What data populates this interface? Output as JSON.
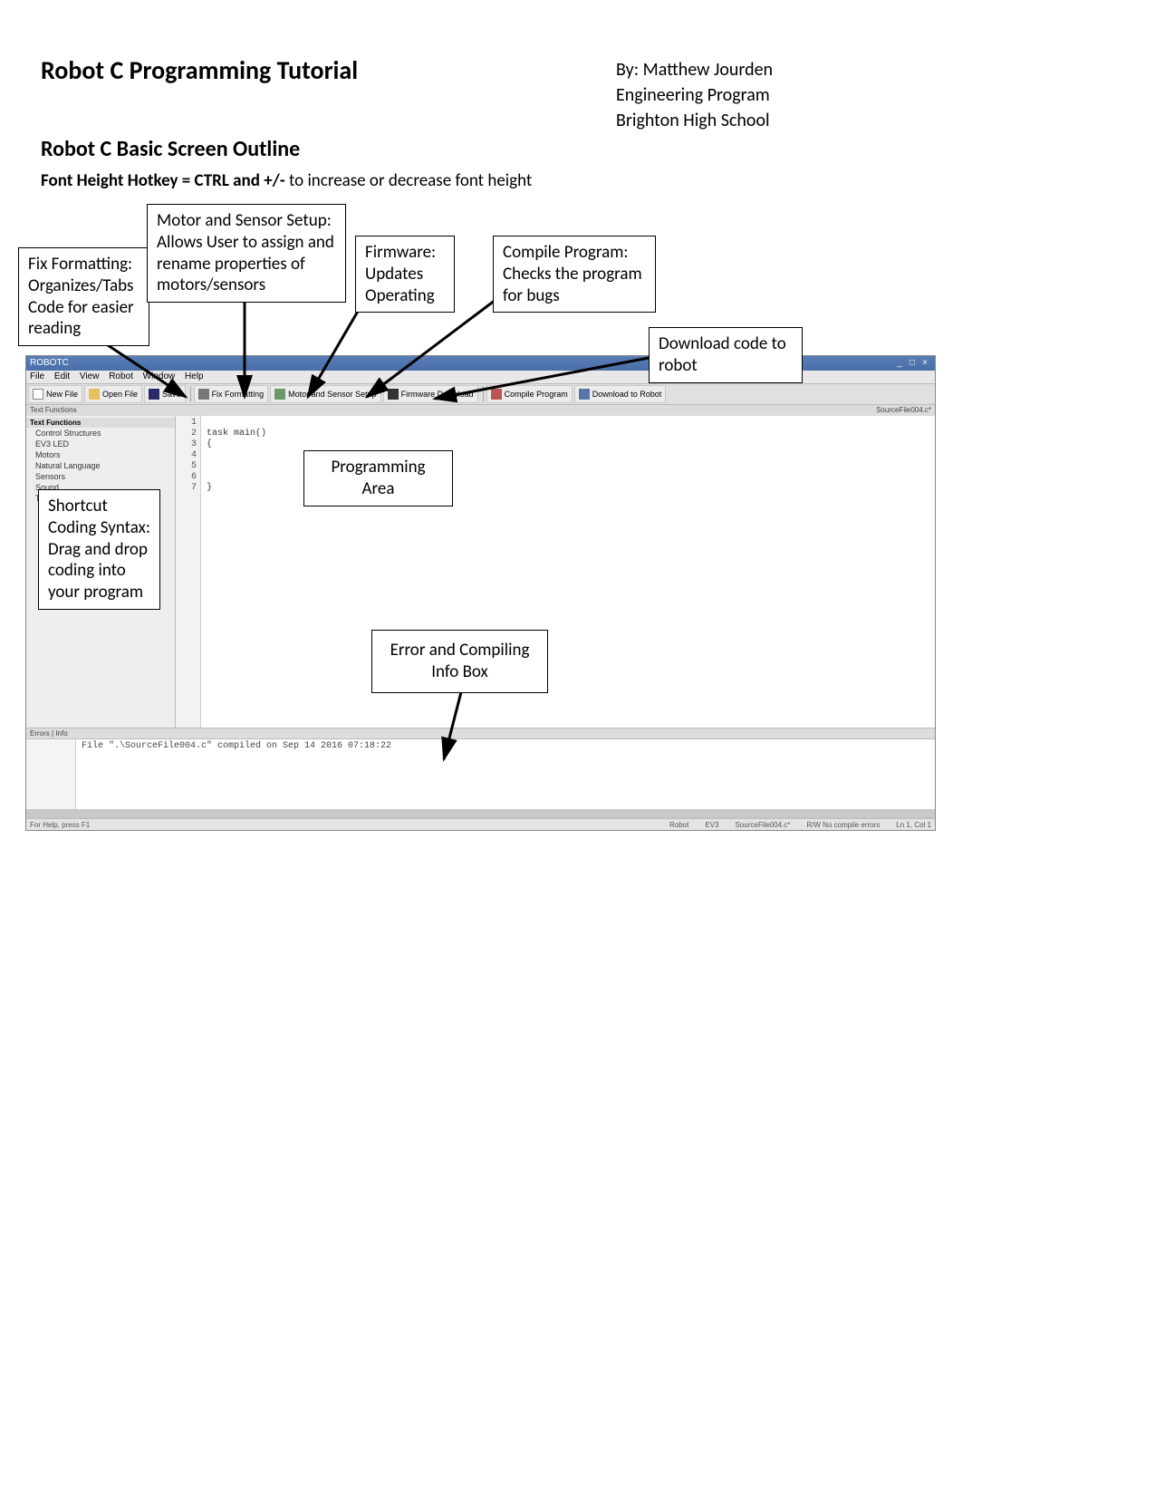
{
  "header": {
    "title": "Robot C Programming Tutorial",
    "by": "By: Matthew Jourden",
    "program": "Engineering Program",
    "school": "Brighton High School"
  },
  "section_title": "Robot C Basic Screen Outline",
  "hotkey_bold": "Font Height Hotkey = CTRL and +/-",
  "hotkey_rest": " to increase or decrease font height",
  "callouts": {
    "fix_formatting": "Fix Formatting: Organizes/Tabs Code for easier reading",
    "motor_sensor": "Motor and Sensor Setup: Allows User to assign and rename properties of motors/sensors",
    "firmware": "Firmware: Updates Operating",
    "compile": "Compile Program: Checks the program for bugs",
    "download": "Download code to robot",
    "prog_area": "Programming Area",
    "shortcut": "Shortcut Coding Syntax: Drag and drop coding into your program",
    "error_box": "Error and Compiling Info Box"
  },
  "ide": {
    "title": "ROBOTC",
    "menus": [
      "File",
      "Edit",
      "View",
      "Robot",
      "Window",
      "Help"
    ],
    "toolbar": {
      "new": "New File",
      "open": "Open File",
      "save": "Save",
      "fix": "Fix Formatting",
      "motor": "Motor and Sensor Setup",
      "firmware": "Firmware Download",
      "compile": "Compile Program",
      "download": "Download to Robot"
    },
    "tabstrip_left": "Text Functions",
    "tabstrip_right": "SourceFile004.c*",
    "sidebar": {
      "header": "Text Functions",
      "items": [
        "Control Structures",
        "EV3 LED",
        "Motors",
        "Natural Language",
        "Sensors",
        "Sound",
        "Timing"
      ]
    },
    "line_numbers": [
      "1",
      "2",
      "3",
      "4",
      "5",
      "6",
      "7"
    ],
    "code_lines": [
      "",
      "task main()",
      "{",
      "",
      "",
      "",
      "}"
    ],
    "err_tabs": "Errors  |  Info",
    "compile_msg": "File \".\\SourceFile004.c\" compiled on Sep 14 2016 07:18:22",
    "status": {
      "left": "For Help, press F1",
      "mid1": "Robot",
      "mid2": "EV3",
      "mid3": "SourceFile004.c*",
      "mid4": "R/W  No compile errors",
      "right": "Ln 1, Col 1"
    }
  }
}
